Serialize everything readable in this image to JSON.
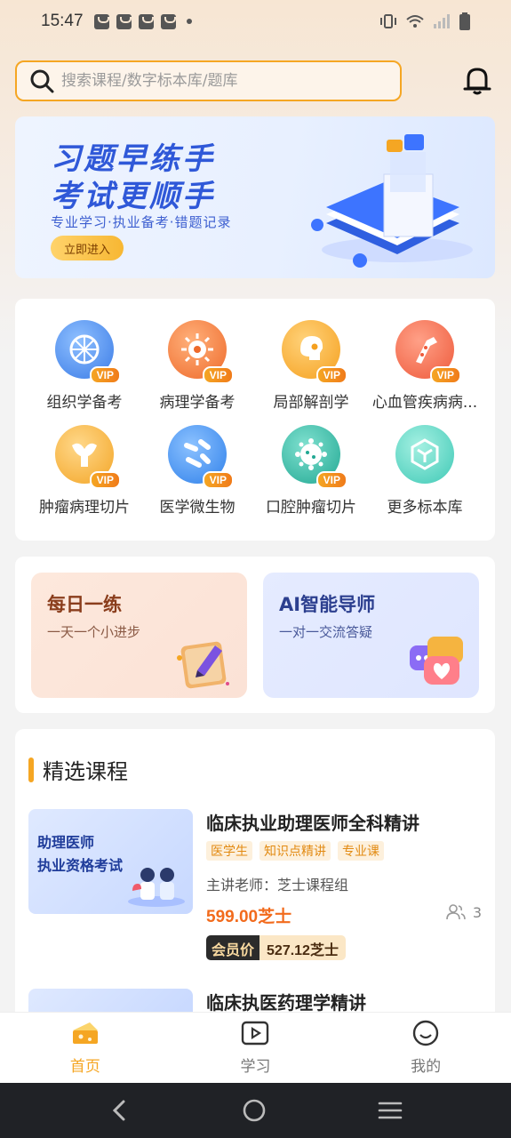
{
  "status_bar": {
    "time": "15:47"
  },
  "search": {
    "placeholder": "搜索课程/数字标本库/题库"
  },
  "banner": {
    "title_line1": "习题早练手",
    "title_line2": "考试更顺手",
    "subtitle": "专业学习·执业备考·错题记录",
    "cta": "立即进入"
  },
  "categories": [
    {
      "label": "组织学备考",
      "vip": "VIP",
      "icon": "tissue-icon",
      "color": "#4a8ef0"
    },
    {
      "label": "病理学备考",
      "vip": "VIP",
      "icon": "virus-icon",
      "color": "#f3793b"
    },
    {
      "label": "局部解剖学",
      "vip": "VIP",
      "icon": "skull-icon",
      "color": "#f5a623"
    },
    {
      "label": "心血管疾病病...",
      "vip": "VIP",
      "icon": "vessel-icon",
      "color": "#f26b4a"
    },
    {
      "label": "肿瘤病理切片",
      "vip": "VIP",
      "icon": "organ-icon",
      "color": "#f5b031"
    },
    {
      "label": "医学微生物",
      "vip": "VIP",
      "icon": "bacteria-icon",
      "color": "#3d8ef2"
    },
    {
      "label": "口腔肿瘤切片",
      "vip": "VIP",
      "icon": "cell-icon",
      "color": "#2fb7a3"
    },
    {
      "label": "更多标本库",
      "vip": "",
      "icon": "cube-icon",
      "color": "#3fc9b6"
    }
  ],
  "features": {
    "daily": {
      "title": "每日一练",
      "desc": "一天一个小进步"
    },
    "ai": {
      "title": "AI智能导师",
      "desc": "一对一交流答疑"
    }
  },
  "courses_section": {
    "title": "精选课程"
  },
  "courses": [
    {
      "name": "临床执业助理医师全科精讲",
      "tags": [
        "医学生",
        "知识点精讲",
        "专业课"
      ],
      "teacher": "主讲老师：芝士课程组",
      "price": "599.00芝士",
      "students": "3",
      "member_label": "会员价",
      "member_price": "527.12芝士",
      "thumb_title1": "助理医师",
      "thumb_title2": "执业资格考试"
    },
    {
      "name": "临床执医药理学精讲"
    }
  ],
  "tabbar": [
    {
      "label": "首页",
      "active": true
    },
    {
      "label": "学习",
      "active": false
    },
    {
      "label": "我的",
      "active": false
    }
  ]
}
